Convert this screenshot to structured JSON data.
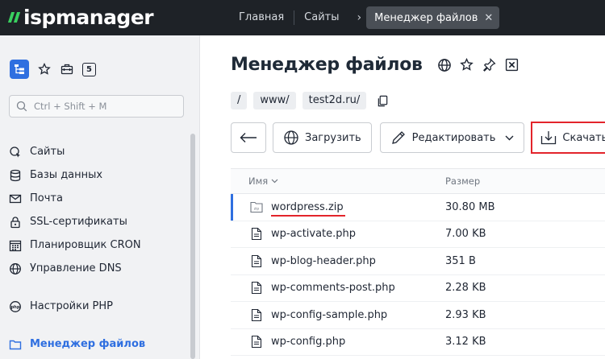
{
  "app": {
    "logo_text": "ispmanager"
  },
  "topnav": {
    "items": [
      "Главная",
      "Сайты"
    ],
    "active_tab": "Менеджер файлов",
    "close_glyph": "✕"
  },
  "sidebar": {
    "quick_badge": "5",
    "search": {
      "placeholder": "Ctrl + Shift + M"
    },
    "items": [
      {
        "label": "Сайты",
        "icon": "sites-icon"
      },
      {
        "label": "Базы данных",
        "icon": "database-icon"
      },
      {
        "label": "Почта",
        "icon": "mail-icon"
      },
      {
        "label": "SSL-сертификаты",
        "icon": "lock-icon"
      },
      {
        "label": "Планировщик CRON",
        "icon": "calendar-icon"
      },
      {
        "label": "Управление DNS",
        "icon": "globe-icon"
      },
      {
        "label": "Настройки PHP",
        "icon": "php-icon"
      },
      {
        "label": "Менеджер файлов",
        "icon": "folder-icon",
        "active": true
      }
    ]
  },
  "main": {
    "title": "Менеджер файлов",
    "breadcrumbs": [
      "/",
      "www/",
      "test2d.ru/"
    ],
    "toolbar": {
      "upload_label": "Загрузить",
      "edit_label": "Редактировать",
      "download_label": "Скачать"
    },
    "table": {
      "col_name": "Имя",
      "col_size": "Размер",
      "rows": [
        {
          "name": "wordpress.zip",
          "size": "30.80 MB",
          "type": "zip"
        },
        {
          "name": "wp-activate.php",
          "size": "7.00 KB",
          "type": "file"
        },
        {
          "name": "wp-blog-header.php",
          "size": "351 B",
          "type": "file"
        },
        {
          "name": "wp-comments-post.php",
          "size": "2.28 KB",
          "type": "file"
        },
        {
          "name": "wp-config-sample.php",
          "size": "2.93 KB",
          "type": "file"
        },
        {
          "name": "wp-config.php",
          "size": "3.12 KB",
          "type": "file"
        }
      ]
    }
  },
  "colors": {
    "accent": "#2f6fe0",
    "highlight": "#e3242b",
    "topbar": "#1e2227",
    "logo_green": "#39d05f"
  }
}
